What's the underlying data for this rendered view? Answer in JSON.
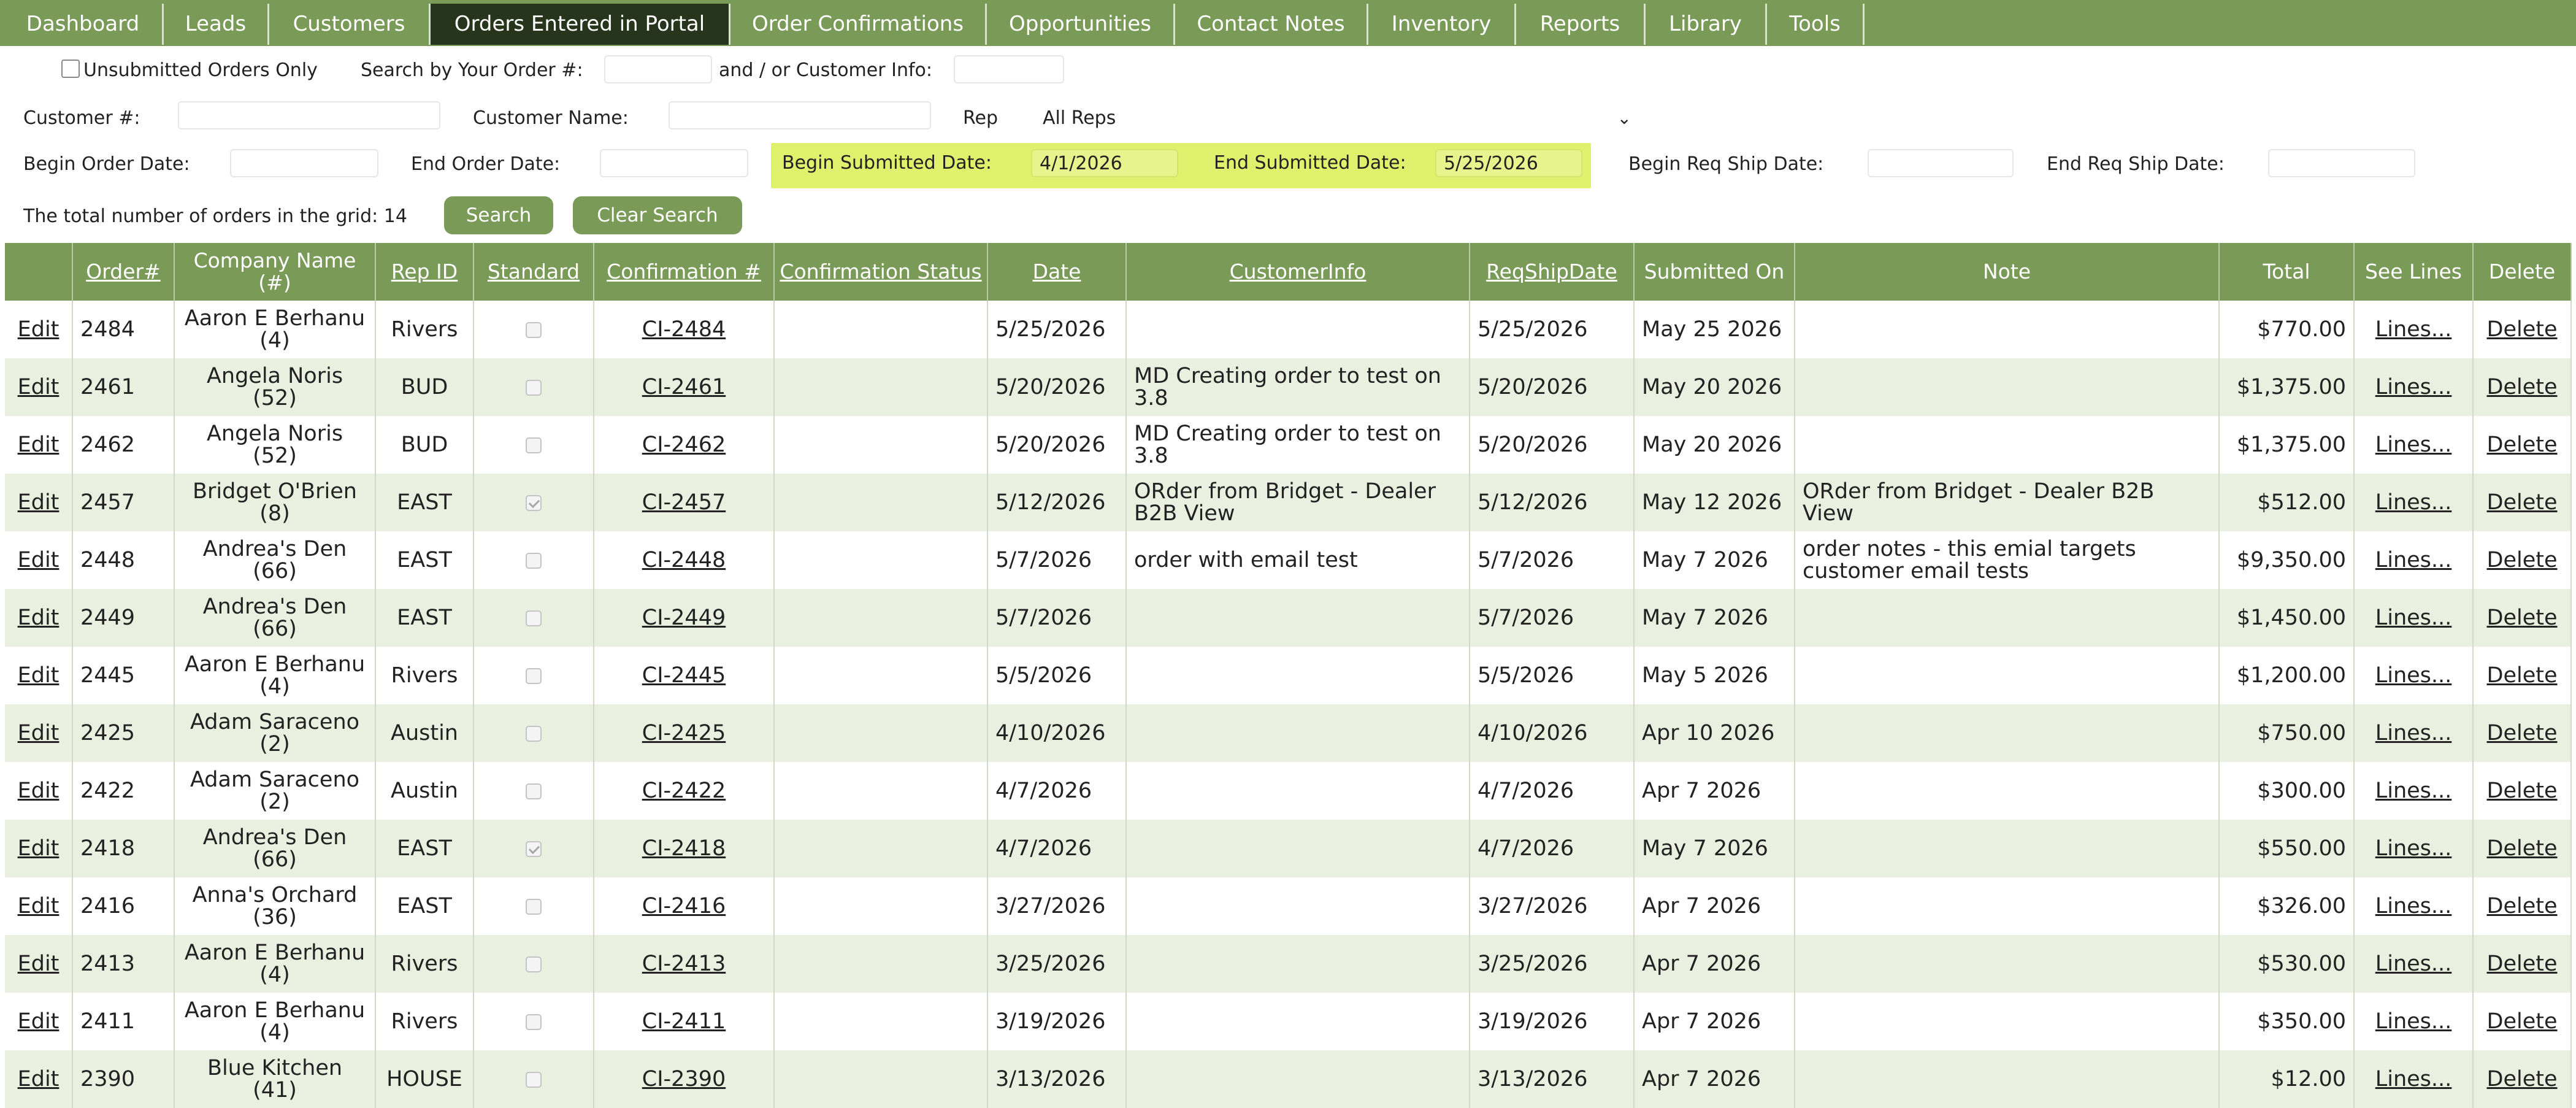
{
  "nav": {
    "tabs": [
      {
        "label": "Dashboard",
        "active": false
      },
      {
        "label": "Leads",
        "active": false
      },
      {
        "label": "Customers",
        "active": false
      },
      {
        "label": "Orders Entered in Portal",
        "active": true
      },
      {
        "label": "Order Confirmations",
        "active": false
      },
      {
        "label": "Opportunities",
        "active": false
      },
      {
        "label": "Contact Notes",
        "active": false
      },
      {
        "label": "Inventory",
        "active": false
      },
      {
        "label": "Reports",
        "active": false
      },
      {
        "label": "Library",
        "active": false
      },
      {
        "label": "Tools",
        "active": false
      }
    ]
  },
  "filters": {
    "unsubmitted_label": "Unsubmitted Orders Only",
    "unsubmitted_checked": false,
    "search_order_label": "Search by Your Order #:",
    "search_order_value": "",
    "customer_info_label": "and / or Customer Info:",
    "customer_info_value": "",
    "customer_num_label": "Customer #:",
    "customer_num_value": "",
    "customer_name_label": "Customer Name:",
    "customer_name_value": "",
    "rep_label": "Rep",
    "rep_selected": "All Reps",
    "begin_order_label": "Begin Order Date:",
    "begin_order_value": "",
    "end_order_label": "End Order Date:",
    "end_order_value": "",
    "begin_submitted_label": "Begin Submitted Date:",
    "begin_submitted_value": "4/1/2026",
    "end_submitted_label": "End Submitted Date:",
    "end_submitted_value": "5/25/2026",
    "begin_reqship_label": "Begin Req Ship Date:",
    "begin_reqship_value": "",
    "end_reqship_label": "End Req Ship Date:",
    "end_reqship_value": "",
    "highlight_color": "#dff06d",
    "total_label": "The total number of orders in the grid: 14",
    "search_button": "Search",
    "clear_button": "Clear Search"
  },
  "grid": {
    "headers": {
      "order": "Order#",
      "company": "Company Name (#)",
      "rep": "Rep ID",
      "standard": "Standard",
      "confirmation": "Confirmation #",
      "conf_status": "Confirmation Status",
      "date": "Date",
      "customer_info": "CustomerInfo",
      "reqship": "ReqShipDate",
      "submitted": "Submitted On",
      "note": "Note",
      "total": "Total",
      "see_lines": "See Lines",
      "delete": "Delete"
    },
    "rows": [
      {
        "edit": "Edit",
        "order": "2484",
        "company": "Aaron E Berhanu (4)",
        "rep": "Rivers",
        "standard": false,
        "confirmation": "CI-2484",
        "conf_status": "",
        "date": "5/25/2026",
        "customer_info": "",
        "reqship": "5/25/2026",
        "submitted": "May 25 2026",
        "note": "",
        "total": "$770.00",
        "lines": "Lines...",
        "delete": "Delete"
      },
      {
        "edit": "Edit",
        "order": "2461",
        "company": "Angela Noris (52)",
        "rep": "BUD",
        "standard": false,
        "confirmation": "CI-2461",
        "conf_status": "",
        "date": "5/20/2026",
        "customer_info": "MD Creating order to test on 3.8",
        "reqship": "5/20/2026",
        "submitted": "May 20 2026",
        "note": "",
        "total": "$1,375.00",
        "lines": "Lines...",
        "delete": "Delete"
      },
      {
        "edit": "Edit",
        "order": "2462",
        "company": "Angela Noris (52)",
        "rep": "BUD",
        "standard": false,
        "confirmation": "CI-2462",
        "conf_status": "",
        "date": "5/20/2026",
        "customer_info": "MD Creating order to test on 3.8",
        "reqship": "5/20/2026",
        "submitted": "May 20 2026",
        "note": "",
        "total": "$1,375.00",
        "lines": "Lines...",
        "delete": "Delete"
      },
      {
        "edit": "Edit",
        "order": "2457",
        "company": "Bridget O'Brien (8)",
        "rep": "EAST",
        "standard": true,
        "confirmation": "CI-2457",
        "conf_status": "",
        "date": "5/12/2026",
        "customer_info": "ORder from Bridget - Dealer B2B View",
        "reqship": "5/12/2026",
        "submitted": "May 12 2026",
        "note": "ORder from Bridget - Dealer B2B View",
        "total": "$512.00",
        "lines": "Lines...",
        "delete": "Delete"
      },
      {
        "edit": "Edit",
        "order": "2448",
        "company": "Andrea's Den (66)",
        "rep": "EAST",
        "standard": false,
        "confirmation": "CI-2448",
        "conf_status": "",
        "date": "5/7/2026",
        "customer_info": "order with email test",
        "reqship": "5/7/2026",
        "submitted": "May 7 2026",
        "note": "order notes - this emial targets customer email tests",
        "total": "$9,350.00",
        "lines": "Lines...",
        "delete": "Delete"
      },
      {
        "edit": "Edit",
        "order": "2449",
        "company": "Andrea's Den (66)",
        "rep": "EAST",
        "standard": false,
        "confirmation": "CI-2449",
        "conf_status": "",
        "date": "5/7/2026",
        "customer_info": "",
        "reqship": "5/7/2026",
        "submitted": "May 7 2026",
        "note": "",
        "total": "$1,450.00",
        "lines": "Lines...",
        "delete": "Delete"
      },
      {
        "edit": "Edit",
        "order": "2445",
        "company": "Aaron E Berhanu (4)",
        "rep": "Rivers",
        "standard": false,
        "confirmation": "CI-2445",
        "conf_status": "",
        "date": "5/5/2026",
        "customer_info": "",
        "reqship": "5/5/2026",
        "submitted": "May 5 2026",
        "note": "",
        "total": "$1,200.00",
        "lines": "Lines...",
        "delete": "Delete"
      },
      {
        "edit": "Edit",
        "order": "2425",
        "company": "Adam Saraceno (2)",
        "rep": "Austin",
        "standard": false,
        "confirmation": "CI-2425",
        "conf_status": "",
        "date": "4/10/2026",
        "customer_info": "",
        "reqship": "4/10/2026",
        "submitted": "Apr 10 2026",
        "note": "",
        "total": "$750.00",
        "lines": "Lines...",
        "delete": "Delete"
      },
      {
        "edit": "Edit",
        "order": "2422",
        "company": "Adam Saraceno (2)",
        "rep": "Austin",
        "standard": false,
        "confirmation": "CI-2422",
        "conf_status": "",
        "date": "4/7/2026",
        "customer_info": "",
        "reqship": "4/7/2026",
        "submitted": "Apr 7 2026",
        "note": "",
        "total": "$300.00",
        "lines": "Lines...",
        "delete": "Delete"
      },
      {
        "edit": "Edit",
        "order": "2418",
        "company": "Andrea's Den (66)",
        "rep": "EAST",
        "standard": true,
        "confirmation": "CI-2418",
        "conf_status": "",
        "date": "4/7/2026",
        "customer_info": "",
        "reqship": "4/7/2026",
        "submitted": "May 7 2026",
        "note": "",
        "total": "$550.00",
        "lines": "Lines...",
        "delete": "Delete"
      },
      {
        "edit": "Edit",
        "order": "2416",
        "company": "Anna's Orchard (36)",
        "rep": "EAST",
        "standard": false,
        "confirmation": "CI-2416",
        "conf_status": "",
        "date": "3/27/2026",
        "customer_info": "",
        "reqship": "3/27/2026",
        "submitted": "Apr 7 2026",
        "note": "",
        "total": "$326.00",
        "lines": "Lines...",
        "delete": "Delete"
      },
      {
        "edit": "Edit",
        "order": "2413",
        "company": "Aaron E Berhanu (4)",
        "rep": "Rivers",
        "standard": false,
        "confirmation": "CI-2413",
        "conf_status": "",
        "date": "3/25/2026",
        "customer_info": "",
        "reqship": "3/25/2026",
        "submitted": "Apr 7 2026",
        "note": "",
        "total": "$530.00",
        "lines": "Lines...",
        "delete": "Delete"
      },
      {
        "edit": "Edit",
        "order": "2411",
        "company": "Aaron E Berhanu (4)",
        "rep": "Rivers",
        "standard": false,
        "confirmation": "CI-2411",
        "conf_status": "",
        "date": "3/19/2026",
        "customer_info": "",
        "reqship": "3/19/2026",
        "submitted": "Apr 7 2026",
        "note": "",
        "total": "$350.00",
        "lines": "Lines...",
        "delete": "Delete"
      },
      {
        "edit": "Edit",
        "order": "2390",
        "company": "Blue Kitchen (41)",
        "rep": "HOUSE",
        "standard": false,
        "confirmation": "CI-2390",
        "conf_status": "",
        "date": "3/13/2026",
        "customer_info": "",
        "reqship": "3/13/2026",
        "submitted": "Apr 7 2026",
        "note": "",
        "total": "$12.00",
        "lines": "Lines...",
        "delete": "Delete"
      }
    ]
  }
}
